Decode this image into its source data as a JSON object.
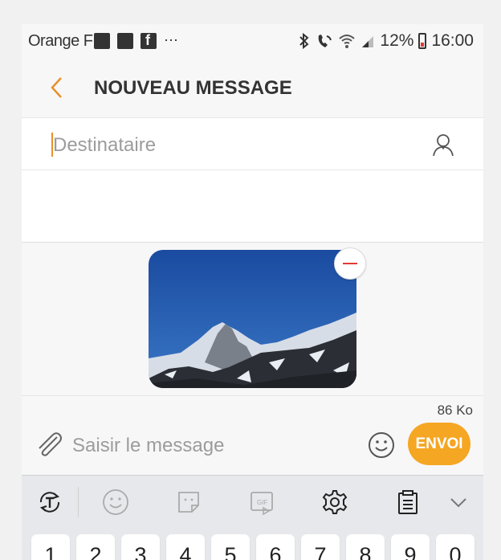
{
  "status_bar": {
    "carrier": "Orange F",
    "dots": "⋯",
    "battery_percent": "12%",
    "time": "16:00"
  },
  "header": {
    "title": "NOUVEAU MESSAGE"
  },
  "recipient": {
    "placeholder": "Destinataire"
  },
  "attachment": {
    "size": "86 Ko"
  },
  "compose": {
    "placeholder": "Saisir le message",
    "send_label": "ENVOI"
  },
  "keyboard": {
    "number_keys": [
      "1",
      "2",
      "3",
      "4",
      "5",
      "6",
      "7",
      "8",
      "9",
      "0"
    ]
  },
  "colors": {
    "accent": "#f5a623",
    "back_arrow": "#e8912a",
    "remove": "#e53935"
  }
}
